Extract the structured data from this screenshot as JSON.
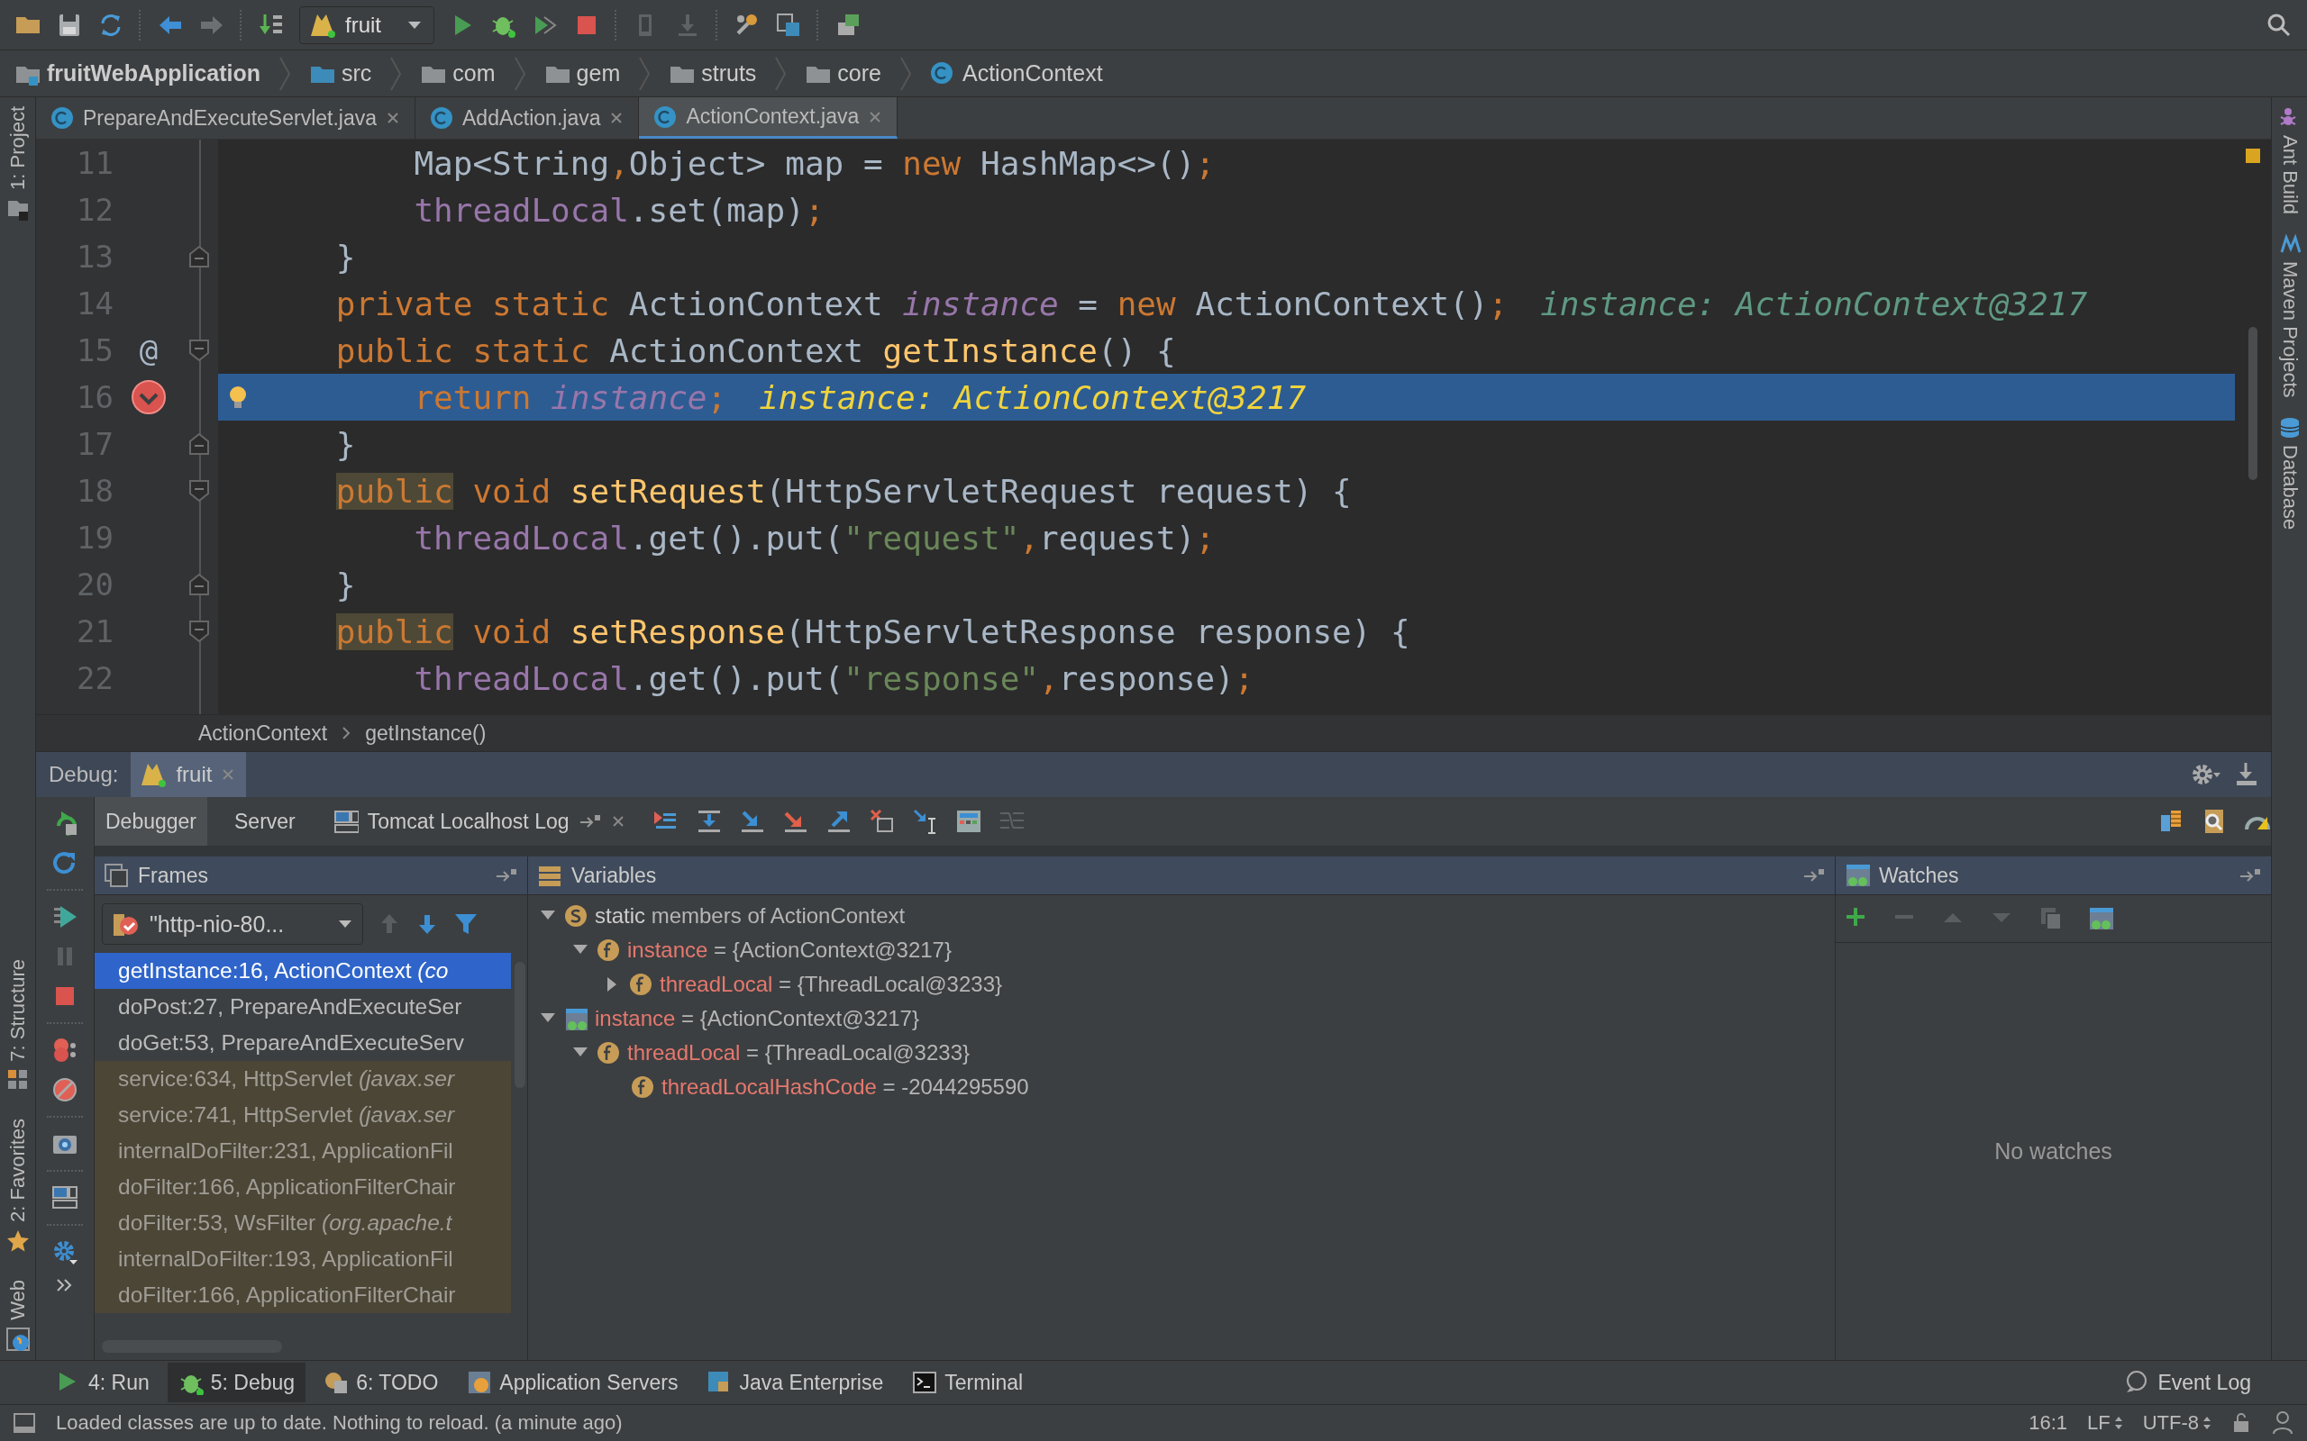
{
  "toolbar": {
    "run_config": "fruit"
  },
  "navigation_bar": [
    {
      "label": "fruitWebApplication",
      "kind": "module"
    },
    {
      "label": "src",
      "kind": "source"
    },
    {
      "label": "com",
      "kind": "package"
    },
    {
      "label": "gem",
      "kind": "package"
    },
    {
      "label": "struts",
      "kind": "package"
    },
    {
      "label": "core",
      "kind": "package"
    },
    {
      "label": "ActionContext",
      "kind": "class"
    }
  ],
  "left_tool_tabs": {
    "top": [
      "1: Project"
    ],
    "bottom": [
      "7: Structure",
      "2: Favorites",
      "Web"
    ]
  },
  "right_tool_tabs": [
    "Ant Build",
    "Maven Projects",
    "Database"
  ],
  "editor_tabs": [
    {
      "label": "PrepareAndExecuteServlet.java",
      "selected": false
    },
    {
      "label": "AddAction.java",
      "selected": false
    },
    {
      "label": "ActionContext.java",
      "selected": true
    }
  ],
  "code_lines": [
    {
      "number": "11",
      "current": false,
      "tokens": [
        {
          "kind": "plain",
          "text": "        Map<String"
        },
        {
          "kind": "keyword",
          "text": ","
        },
        {
          "kind": "plain",
          "text": "Object> map = "
        },
        {
          "kind": "keyword",
          "text": "new "
        },
        {
          "kind": "plain",
          "text": "HashMap<>()"
        },
        {
          "kind": "keyword",
          "text": ";"
        }
      ]
    },
    {
      "number": "12",
      "current": false,
      "tokens": [
        {
          "kind": "field",
          "text": "        threadLocal"
        },
        {
          "kind": "plain",
          "text": ".set(map)"
        },
        {
          "kind": "keyword",
          "text": ";"
        }
      ]
    },
    {
      "number": "13",
      "current": false,
      "fold_end": true,
      "tokens": [
        {
          "kind": "plain",
          "text": "    }"
        }
      ]
    },
    {
      "number": "14",
      "current": false,
      "tokens": [
        {
          "kind": "keyword",
          "text": "    private static "
        },
        {
          "kind": "plain",
          "text": "ActionContext "
        },
        {
          "kind": "static_field",
          "text": "instance"
        },
        {
          "kind": "plain",
          "text": " = "
        },
        {
          "kind": "keyword",
          "text": "new "
        },
        {
          "kind": "plain",
          "text": "ActionContext()"
        },
        {
          "kind": "keyword",
          "text": ";"
        }
      ],
      "inline_value": "instance: ActionContext@3217"
    },
    {
      "number": "15",
      "current": false,
      "marker": "@",
      "fold_start": true,
      "tokens": [
        {
          "kind": "keyword",
          "text": "    public static "
        },
        {
          "kind": "plain",
          "text": "ActionContext "
        },
        {
          "kind": "method",
          "text": "getInstance"
        },
        {
          "kind": "plain",
          "text": "() {"
        }
      ]
    },
    {
      "number": "16",
      "current": true,
      "breakpoint": true,
      "hint": true,
      "tokens": [
        {
          "kind": "keyword",
          "text": "        return "
        },
        {
          "kind": "static_field",
          "text": "instance"
        },
        {
          "kind": "keyword",
          "text": ";"
        }
      ],
      "inline_value": "instance: ActionContext@3217"
    },
    {
      "number": "17",
      "current": false,
      "fold_end": true,
      "tokens": [
        {
          "kind": "plain",
          "text": "    }"
        }
      ]
    },
    {
      "number": "18",
      "current": false,
      "fold_start": true,
      "tokens": [
        {
          "kind": "keyword_highlighted",
          "text": "    public"
        },
        {
          "kind": "keyword",
          "text": " void "
        },
        {
          "kind": "method",
          "text": "setRequest"
        },
        {
          "kind": "plain",
          "text": "(HttpServletRequest request) {"
        }
      ]
    },
    {
      "number": "19",
      "current": false,
      "tokens": [
        {
          "kind": "field",
          "text": "        threadLocal"
        },
        {
          "kind": "plain",
          "text": ".get().put("
        },
        {
          "kind": "string",
          "text": "\"request\""
        },
        {
          "kind": "keyword",
          "text": ","
        },
        {
          "kind": "plain",
          "text": "request)"
        },
        {
          "kind": "keyword",
          "text": ";"
        }
      ]
    },
    {
      "number": "20",
      "current": false,
      "fold_end": true,
      "tokens": [
        {
          "kind": "plain",
          "text": "    }"
        }
      ]
    },
    {
      "number": "21",
      "current": false,
      "fold_start": true,
      "tokens": [
        {
          "kind": "keyword_highlighted",
          "text": "    public"
        },
        {
          "kind": "keyword",
          "text": " void "
        },
        {
          "kind": "method",
          "text": "setResponse"
        },
        {
          "kind": "plain",
          "text": "(HttpServletResponse response) {"
        }
      ]
    },
    {
      "number": "22",
      "current": false,
      "tokens": [
        {
          "kind": "field",
          "text": "        threadLocal"
        },
        {
          "kind": "plain",
          "text": ".get().put("
        },
        {
          "kind": "string",
          "text": "\"response\""
        },
        {
          "kind": "keyword",
          "text": ","
        },
        {
          "kind": "plain",
          "text": "response)"
        },
        {
          "kind": "keyword",
          "text": ";"
        }
      ]
    }
  ],
  "editor_breadcrumb": [
    "ActionContext",
    "getInstance()"
  ],
  "debug": {
    "title": "Debug:",
    "sessions": [
      {
        "label": "fruit",
        "selected": true
      }
    ],
    "tabs": [
      {
        "label": "Debugger",
        "selected": true
      },
      {
        "label": "Server",
        "selected": false
      },
      {
        "label": "Tomcat Localhost Log",
        "selected": false
      }
    ],
    "frames": {
      "title": "Frames",
      "thread": "\"http-nio-80...",
      "items": [
        {
          "text": "getInstance:16, ActionContext *(co*",
          "selected": true,
          "library": false
        },
        {
          "text": "doPost:27, PrepareAndExecuteSer",
          "selected": false,
          "library": false
        },
        {
          "text": "doGet:53, PrepareAndExecuteServ",
          "selected": false,
          "library": false
        },
        {
          "text": "service:634, HttpServlet *(javax.ser*",
          "selected": false,
          "library": true
        },
        {
          "text": "service:741, HttpServlet *(javax.ser*",
          "selected": false,
          "library": true
        },
        {
          "text": "internalDoFilter:231, ApplicationFil",
          "selected": false,
          "library": true
        },
        {
          "text": "doFilter:166, ApplicationFilterChair",
          "selected": false,
          "library": true
        },
        {
          "text": "doFilter:53, WsFilter *(org.apache.t*",
          "selected": false,
          "library": true
        },
        {
          "text": "internalDoFilter:193, ApplicationFil",
          "selected": false,
          "library": true
        },
        {
          "text": "doFilter:166, ApplicationFilterChair",
          "selected": false,
          "library": true
        }
      ]
    },
    "variables": {
      "title": "Variables",
      "tree": [
        {
          "kind": "static",
          "name": "static",
          "value": "members of ActionContext",
          "expanded": true,
          "children": [
            {
              "kind": "field",
              "name": "instance",
              "value": "= {ActionContext@3217}",
              "expanded": true,
              "children": [
                {
                  "kind": "field",
                  "name": "threadLocal",
                  "value": "= {ThreadLocal@3233}",
                  "expanded": false
                }
              ]
            }
          ]
        },
        {
          "kind": "watch",
          "name": "instance",
          "value": "= {ActionContext@3217}",
          "expanded": true,
          "children": [
            {
              "kind": "field",
              "name": "threadLocal",
              "value": "= {ThreadLocal@3233}",
              "expanded": true,
              "children": [
                {
                  "kind": "field",
                  "name": "threadLocalHashCode",
                  "value": "= -2044295590"
                }
              ]
            }
          ]
        }
      ]
    },
    "watches": {
      "title": "Watches",
      "empty_text": "No watches"
    }
  },
  "tool_windows": [
    {
      "label": "4: Run",
      "selected": false
    },
    {
      "label": "5: Debug",
      "selected": true
    },
    {
      "label": "6: TODO",
      "selected": false
    },
    {
      "label": "Application Servers",
      "selected": false
    },
    {
      "label": "Java Enterprise",
      "selected": false
    },
    {
      "label": "Terminal",
      "selected": false
    }
  ],
  "event_log": "Event Log",
  "status_bar": {
    "message": "Loaded classes are up to date. Nothing to reload. (a minute ago)",
    "position": "16:1",
    "line_separator": "LF",
    "encoding": "UTF-8"
  }
}
